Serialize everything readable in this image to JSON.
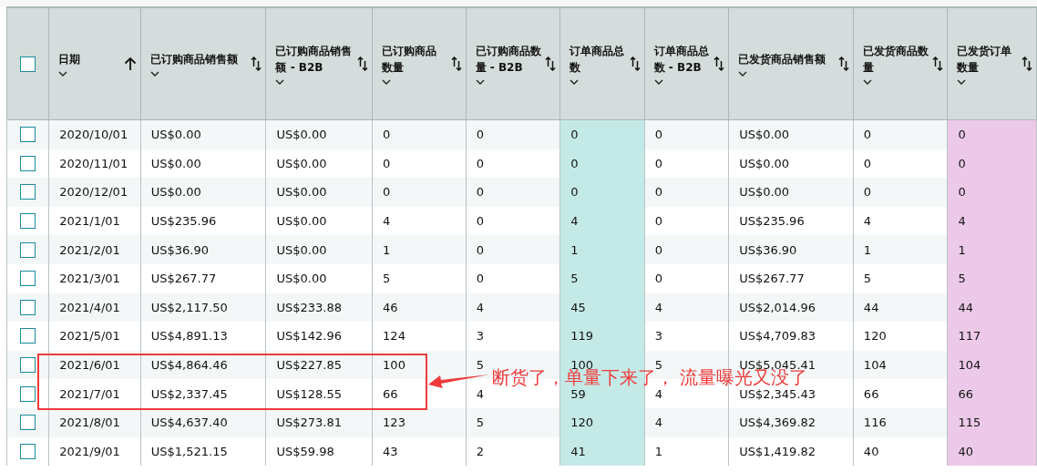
{
  "table": {
    "select_all": {
      "checked": false
    },
    "columns": [
      {
        "label": "日期",
        "sorted": true
      },
      {
        "label": "已订购商品销售额",
        "sorted": false
      },
      {
        "label": "已订购商品销售额 - B2B",
        "sorted": false
      },
      {
        "label": "已订购商品数量",
        "sorted": false
      },
      {
        "label": "已订购商品数量 - B2B",
        "sorted": false
      },
      {
        "label": "订单商品总数",
        "sorted": false,
        "color": "#c4eae7"
      },
      {
        "label": "订单商品总数 - B2B",
        "sorted": false
      },
      {
        "label": "已发货商品销售额",
        "sorted": false
      },
      {
        "label": "已发货商品数量",
        "sorted": false
      },
      {
        "label": "已发货订单数量",
        "sorted": false,
        "color": "#ecc9e8"
      }
    ],
    "rows": [
      {
        "checked": false,
        "cells": [
          "2020/10/01",
          "US$0.00",
          "US$0.00",
          "0",
          "0",
          "0",
          "0",
          "US$0.00",
          "0",
          "0"
        ]
      },
      {
        "checked": false,
        "cells": [
          "2020/11/01",
          "US$0.00",
          "US$0.00",
          "0",
          "0",
          "0",
          "0",
          "US$0.00",
          "0",
          "0"
        ]
      },
      {
        "checked": false,
        "cells": [
          "2020/12/01",
          "US$0.00",
          "US$0.00",
          "0",
          "0",
          "0",
          "0",
          "US$0.00",
          "0",
          "0"
        ]
      },
      {
        "checked": false,
        "cells": [
          "2021/1/01",
          "US$235.96",
          "US$0.00",
          "4",
          "0",
          "4",
          "0",
          "US$235.96",
          "4",
          "4"
        ]
      },
      {
        "checked": false,
        "cells": [
          "2021/2/01",
          "US$36.90",
          "US$0.00",
          "1",
          "0",
          "1",
          "0",
          "US$36.90",
          "1",
          "1"
        ]
      },
      {
        "checked": false,
        "cells": [
          "2021/3/01",
          "US$267.77",
          "US$0.00",
          "5",
          "0",
          "5",
          "0",
          "US$267.77",
          "5",
          "5"
        ]
      },
      {
        "checked": false,
        "cells": [
          "2021/4/01",
          "US$2,117.50",
          "US$233.88",
          "46",
          "4",
          "45",
          "4",
          "US$2,014.96",
          "44",
          "44"
        ]
      },
      {
        "checked": false,
        "cells": [
          "2021/5/01",
          "US$4,891.13",
          "US$142.96",
          "124",
          "3",
          "119",
          "3",
          "US$4,709.83",
          "120",
          "117"
        ]
      },
      {
        "checked": false,
        "cells": [
          "2021/6/01",
          "US$4,864.46",
          "US$227.85",
          "100",
          "5",
          "100",
          "5",
          "US$5,045.41",
          "104",
          "104"
        ]
      },
      {
        "checked": false,
        "cells": [
          "2021/7/01",
          "US$2,337.45",
          "US$128.55",
          "66",
          "4",
          "59",
          "4",
          "US$2,345.43",
          "66",
          "66"
        ]
      },
      {
        "checked": false,
        "cells": [
          "2021/8/01",
          "US$4,637.40",
          "US$273.81",
          "123",
          "5",
          "120",
          "4",
          "US$4,369.82",
          "116",
          "115"
        ]
      },
      {
        "checked": false,
        "cells": [
          "2021/9/01",
          "US$1,521.15",
          "US$59.98",
          "43",
          "2",
          "41",
          "1",
          "US$1,419.82",
          "40",
          "40"
        ]
      }
    ]
  },
  "annotation": {
    "text": "断货了，单量下来了， 流量曝光又没了"
  }
}
